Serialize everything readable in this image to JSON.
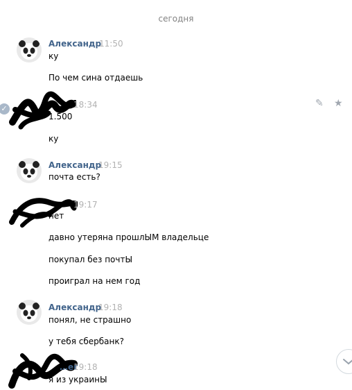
{
  "chat": {
    "date_separator": "сегодня",
    "messages": [
      {
        "author": "Александр",
        "time": "11:50",
        "lines": [
          "ку",
          "По чем сина отдаешь"
        ]
      },
      {
        "author": "",
        "time": "18:34",
        "lines": [
          "1.500",
          "ку"
        ]
      },
      {
        "author": "Александр",
        "time": "19:15",
        "lines": [
          "почта есть?"
        ]
      },
      {
        "author": "",
        "time": "19:17",
        "lines": [
          "нет",
          "давно утеряна прошлЫМ владельце",
          "покупал без почтЫ",
          "проиграл на нем год"
        ]
      },
      {
        "author": "Александр",
        "time": "19:18",
        "lines": [
          "понял, не страшно",
          "у тебя сбербанк?"
        ]
      },
      {
        "author": "…ег",
        "time": "19:18",
        "lines": [
          "я из украинЫ"
        ]
      }
    ]
  },
  "icons": {
    "edit": "pencil-icon",
    "favorite": "star-icon",
    "scroll": "chevron-down-icon"
  }
}
